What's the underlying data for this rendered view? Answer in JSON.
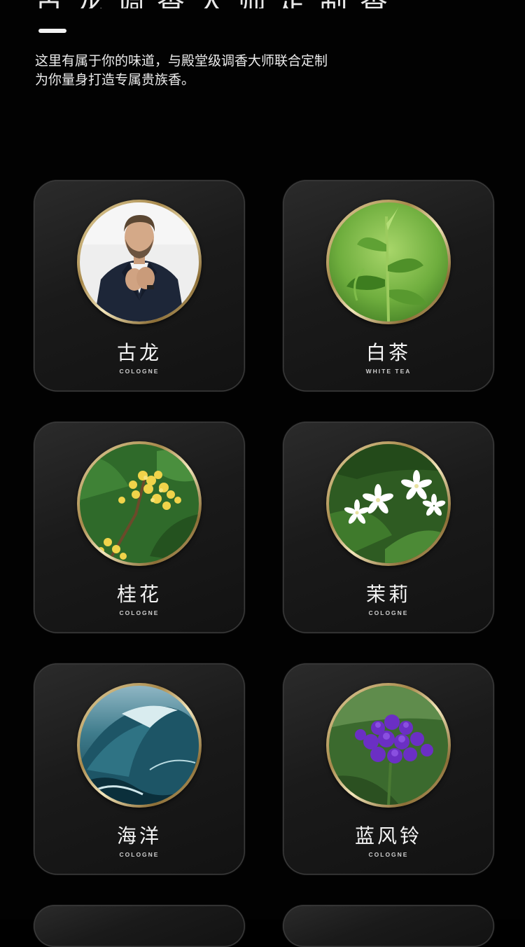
{
  "header": {
    "heading_partial": "古龙调香大师定制香氛"
  },
  "intro": {
    "line1": "这里有属于你的味道，与殿堂级调香大师联合定制",
    "line2": "为你量身打造专属贵族香。"
  },
  "scents": [
    {
      "name": "古龙",
      "subtitle": "COLOGNE",
      "image": "man-in-suit-portrait"
    },
    {
      "name": "白茶",
      "subtitle": "WHITE TEA",
      "image": "tea-leaves"
    },
    {
      "name": "桂花",
      "subtitle": "COLOGNE",
      "image": "osmanthus-flowers"
    },
    {
      "name": "茉莉",
      "subtitle": "COLOGNE",
      "image": "jasmine-flowers"
    },
    {
      "name": "海洋",
      "subtitle": "COLOGNE",
      "image": "ocean-wave"
    },
    {
      "name": "蓝风铃",
      "subtitle": "COLOGNE",
      "image": "bluebell-flowers"
    }
  ],
  "colors": {
    "background": "#020202",
    "card": "#1f1f1f",
    "gold_ring": "#c2a566",
    "text": "#f4f4f4"
  }
}
